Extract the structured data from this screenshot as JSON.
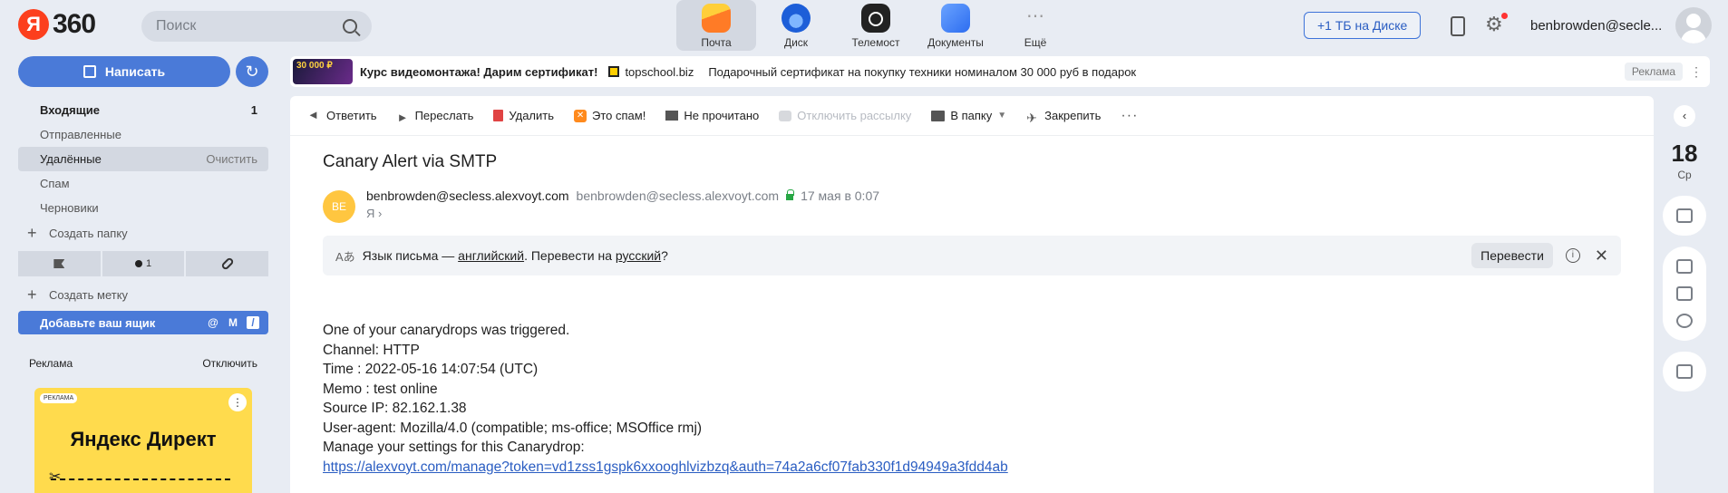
{
  "header": {
    "logo_letter": "Я",
    "logo_text": "360",
    "search_placeholder": "Поиск",
    "apps": [
      {
        "label": "Почта",
        "icon": "mail-icon",
        "active": true
      },
      {
        "label": "Диск",
        "icon": "disk-icon"
      },
      {
        "label": "Телемост",
        "icon": "telemost-icon"
      },
      {
        "label": "Документы",
        "icon": "docs-icon"
      },
      {
        "label": "Ещё",
        "icon": "more-icon"
      }
    ],
    "disk_button": "+1 ТБ на Диске",
    "user_name": "benbrowden@secle..."
  },
  "sidebar": {
    "compose_label": "Написать",
    "folders": [
      {
        "name": "Входящие",
        "count": "1"
      },
      {
        "name": "Отправленные"
      },
      {
        "name": "Удалённые",
        "action": "Очистить"
      },
      {
        "name": "Спам"
      },
      {
        "name": "Черновики"
      }
    ],
    "create_folder": "Создать папку",
    "filter_unread_count": "1",
    "create_label": "Создать метку",
    "add_mailbox": "Добавьте ваш ящик",
    "add_mailbox_slash": "/",
    "ad_title": "Реклама",
    "ad_disable": "Отключить",
    "direct_badge": "РЕКЛАМА",
    "direct_title": "Яндекс Директ"
  },
  "banner": {
    "thumb_text": "30 000 ₽",
    "title": "Курс видеомонтажа! Дарим сертификат!",
    "site": "topschool.biz",
    "description": "Подарочный сертификат на покупку техники номиналом 30 000 руб в подарок",
    "tag": "Реклама"
  },
  "toolbar": {
    "reply": "Ответить",
    "forward": "Переслать",
    "delete": "Удалить",
    "spam": "Это спам!",
    "unread": "Не прочитано",
    "unsubscribe": "Отключить рассылку",
    "to_folder": "В папку",
    "pin": "Закрепить"
  },
  "message": {
    "subject": "Canary Alert via SMTP",
    "avatar_initials": "BE",
    "sender_name": "benbrowden@secless.alexvoyt.com",
    "sender_email": "benbrowden@secless.alexvoyt.com",
    "date": "17 мая в 0:07",
    "recipient": "Я ›",
    "translate": {
      "prefix": "Язык письма — ",
      "lang_from": "английский",
      "middle": ". Перевести на ",
      "lang_to": "русский",
      "suffix": "?",
      "button": "Перевести"
    },
    "body_lines": [
      "One of your canarydrops was triggered.",
      "Channel: HTTP",
      "Time : 2022-05-16 14:07:54 (UTC)",
      "Memo : test online",
      "Source IP: 82.162.1.38",
      "User-agent: Mozilla/4.0 (compatible; ms-office; MSOffice rmj)",
      "Manage your settings for this Canarydrop:"
    ],
    "link": "https://alexvoyt.com/manage?token=vd1zss1gspk6xxooghlvizbzq&auth=74a2a6cf07fab330f1d94949a3fdd4ab"
  },
  "rail": {
    "day": "18",
    "weekday": "Ср"
  }
}
